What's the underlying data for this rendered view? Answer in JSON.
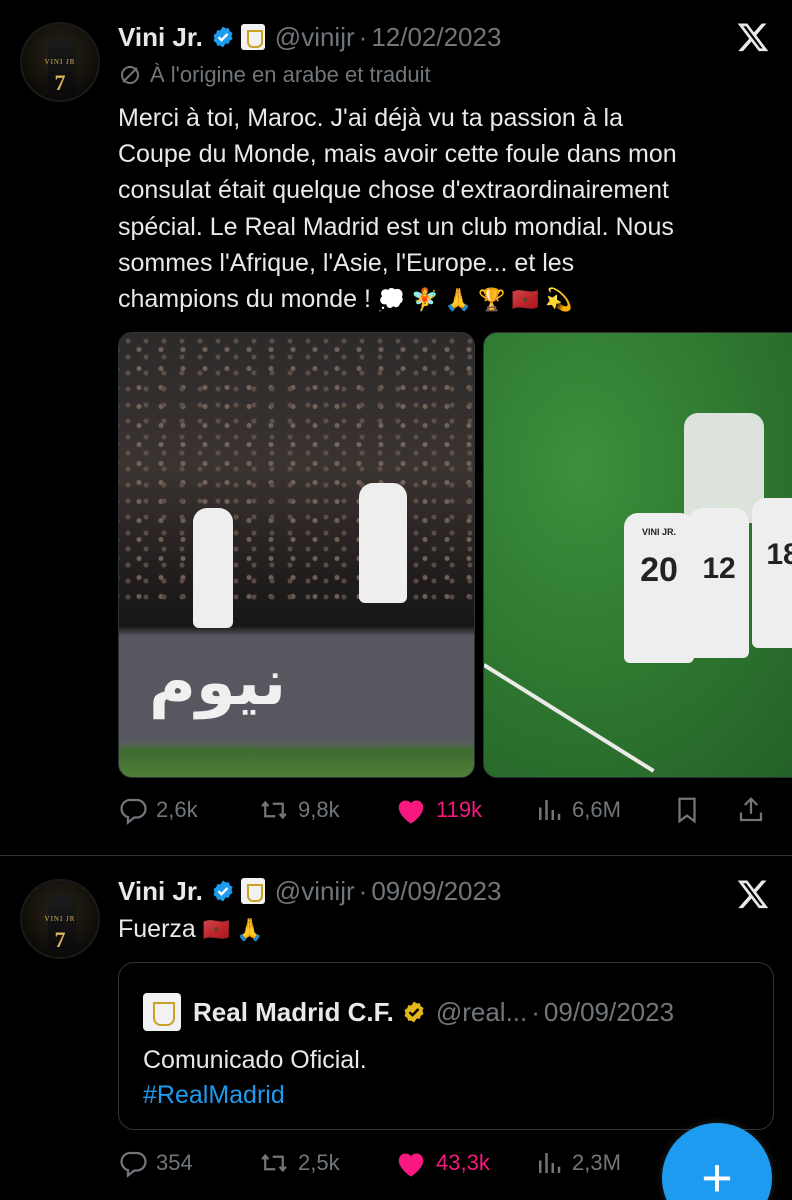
{
  "tweet1": {
    "author_name": "Vini Jr.",
    "handle": "@vinijr",
    "separator": "·",
    "date": "12/02/2023",
    "translated_note": "À l'origine en arabe et traduit",
    "text_lines": [
      "Merci à toi, Maroc. J'ai déjà vu ta passion à la",
      "Coupe du Monde, mais avoir cette foule dans mon",
      "consulat était quelque chose d'extraordinairement",
      "spécial. Le Real Madrid est un club mondial. Nous",
      "sommes l'Afrique, l'Asie, l'Europe... et les",
      "champions du monde !"
    ],
    "text_emojis": "💭 🧚 🙏 🏆 🇲🇦 💫",
    "billboard_text": "نيوم",
    "photo2_jersey_numbers": [
      "20",
      "12",
      "18"
    ],
    "photo2_jersey_name": "VINI JR.",
    "actions": {
      "replies": "2,6k",
      "reposts": "9,8k",
      "likes": "119k",
      "views": "6,6M"
    }
  },
  "tweet2": {
    "author_name": "Vini Jr.",
    "handle": "@vinijr",
    "separator": "·",
    "date": "09/09/2023",
    "text": "Fuerza",
    "text_emojis": "🇲🇦 🙏",
    "quote": {
      "author_name": "Real Madrid C.F.",
      "handle": "@real...",
      "separator": "·",
      "date": "09/09/2023",
      "text": "Comunicado Oficial.",
      "hashtag": "#RealMadrid"
    },
    "actions": {
      "replies": "354",
      "reposts": "2,5k",
      "likes": "43,3k",
      "views": "2,3M"
    }
  },
  "avatar_label": "VINI JR",
  "avatar_number": "7",
  "fab_label": "+",
  "colors": {
    "background": "#000000",
    "text": "#e7e9ea",
    "muted": "#71767b",
    "accent_blue": "#1d9bf0",
    "like_pink": "#f91880",
    "gold_badge": "#e2b719"
  },
  "icons": [
    "verified-badge-icon",
    "x-logo-icon",
    "translate-icon",
    "reply-icon",
    "repost-icon",
    "like-icon",
    "views-icon",
    "bookmark-icon",
    "share-icon",
    "plus-icon"
  ]
}
